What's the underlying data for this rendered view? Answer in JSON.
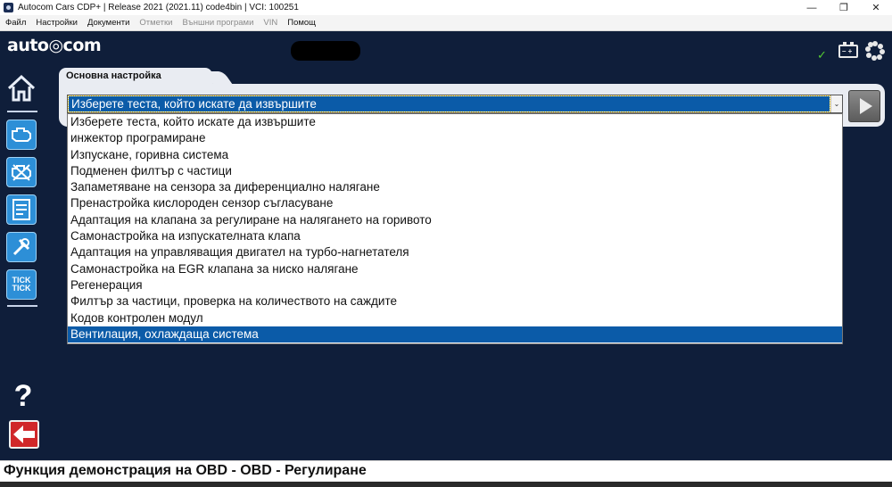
{
  "window": {
    "title": "Autocom Cars CDP+ | Release 2021 (2021.11) code4bin | VCI: 100251",
    "controls": {
      "minimize": "—",
      "maximize": "❐",
      "close": "✕"
    }
  },
  "menu": {
    "items": [
      {
        "label": "Файл",
        "enabled": true
      },
      {
        "label": "Настройки",
        "enabled": true
      },
      {
        "label": "Документи",
        "enabled": true
      },
      {
        "label": "Отметки",
        "enabled": false
      },
      {
        "label": "Външни програми",
        "enabled": false
      },
      {
        "label": "VIN",
        "enabled": false
      },
      {
        "label": "Помощ",
        "enabled": true
      }
    ]
  },
  "header": {
    "logo": "auto◎com",
    "status_check": "✓",
    "battery_symbol": "– +"
  },
  "sidebar": {
    "icons": [
      "home-icon",
      "engine-icon",
      "engine-fault-icon",
      "diagnostics-icon",
      "tools-icon",
      "tick-tick-icon",
      "help-icon",
      "back-arrow-icon"
    ],
    "tick_label_1": "TICK",
    "tick_label_2": "TICK",
    "help_label": "?"
  },
  "panel": {
    "tab_title": "Основна настройка",
    "select": {
      "value": "Изберете теста, който искате да извършите",
      "arrow": "⌄"
    },
    "dropdown": {
      "options": [
        "Изберете теста, който искате да извършите",
        "инжектор програмиране",
        "Изпускане, горивна система",
        "Подменен филтър с частици",
        "Запаметяване на сензора за диференциално налягане",
        "Пренастройка кислороден сензор съгласуване",
        "Адаптация на клапана за регулиране на налягането на горивото",
        "Самонастройка на изпускателната клапа",
        "Адаптация на управляващия двигател на турбо-нагнетателя",
        "Самонастройка на EGR клапана за ниско налягане",
        "Регенерация",
        "Филтър за частици, проверка на количеството на саждите",
        "Кодов контролен модул",
        "Вентилация, охлаждаща система"
      ],
      "highlighted_index": 13
    }
  },
  "statusbar": {
    "text": "Функция демонстрация на OBD - OBD - Регулиране"
  },
  "colors": {
    "background": "#0f1e3a",
    "selection": "#0b5ba8",
    "sidebar_button": "#2d8fd7",
    "back_button": "#d0272a",
    "check": "#55cc33"
  }
}
